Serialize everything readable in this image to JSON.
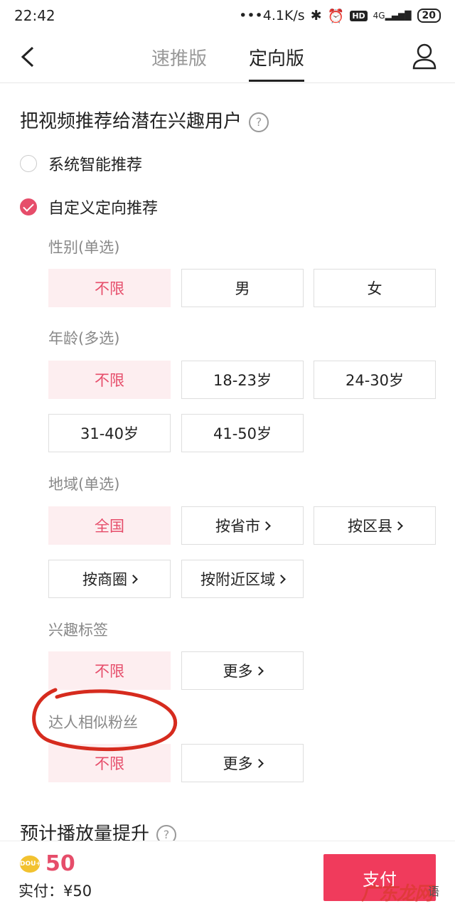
{
  "status": {
    "time": "22:42",
    "speed": "•••4.1K/s",
    "hd": "HD",
    "net": "4G",
    "battery": "20"
  },
  "nav": {
    "tab_fast": "速推版",
    "tab_target": "定向版"
  },
  "section": {
    "title": "把视频推荐给潜在兴趣用户",
    "help": "?"
  },
  "options": {
    "system": "系统智能推荐",
    "custom": "自定义定向推荐"
  },
  "gender": {
    "label": "性别(单选)",
    "opts": [
      "不限",
      "男",
      "女"
    ]
  },
  "age": {
    "label": "年龄(多选)",
    "opts": [
      "不限",
      "18-23岁",
      "24-30岁",
      "31-40岁",
      "41-50岁"
    ]
  },
  "region": {
    "label": "地域(单选)",
    "opts": [
      "全国",
      "按省市",
      "按区县",
      "按商圈",
      "按附近区域"
    ]
  },
  "interest": {
    "label": "兴趣标签",
    "opts": [
      "不限",
      "更多"
    ]
  },
  "similar": {
    "label": "达人相似粉丝",
    "opts": [
      "不限",
      "更多"
    ]
  },
  "estimate": {
    "title": "预计播放量提升",
    "help": "?"
  },
  "bottom": {
    "coin": "DOU+",
    "amount": "50",
    "paid": "实付：¥50",
    "pay": "支付"
  },
  "watermark": {
    "brand": "广东龙网",
    "suffix": "语"
  },
  "colors": {
    "accent": "#e64d6a",
    "selected_bg": "#fdeef0",
    "annotation": "#d62b1e"
  }
}
